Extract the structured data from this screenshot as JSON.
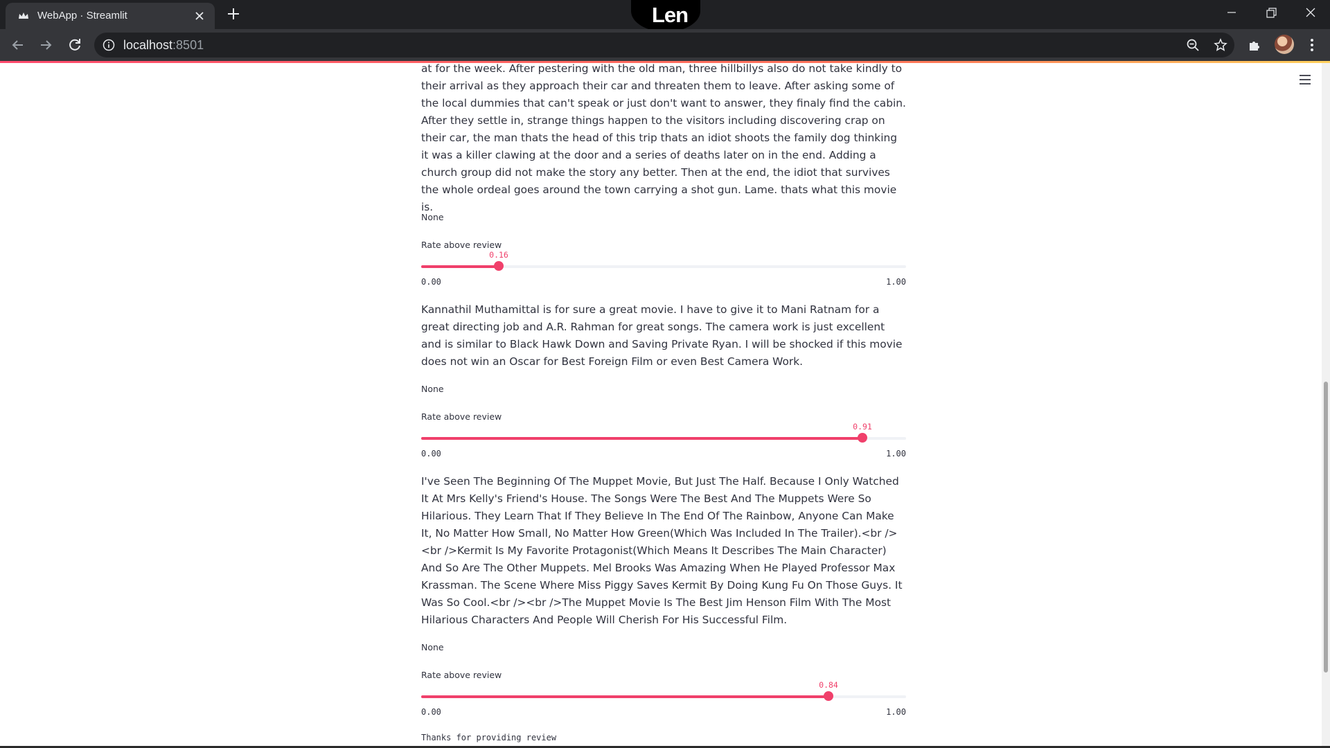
{
  "browser": {
    "tab_title": "WebApp · Streamlit",
    "overlay_text": "Len",
    "url_host": "localhost",
    "url_port": ":8501",
    "icons": {
      "favicon": "streamlit-crown-icon",
      "tab_close": "close-icon",
      "new_tab": "plus-icon",
      "minimize": "minimize-icon",
      "restore": "restore-icon",
      "close_window": "close-icon",
      "back": "arrow-left-icon",
      "forward": "arrow-right-icon",
      "reload": "reload-icon",
      "site_info": "info-icon",
      "zoom": "zoom-out-icon",
      "bookmark": "star-icon",
      "extensions": "puzzle-icon",
      "profile": "avatar",
      "menu": "kebab-menu-icon"
    }
  },
  "app": {
    "menu_icon": "hamburger-icon",
    "accent_color": "#f0406b",
    "text_color": "#31333f",
    "reviews": [
      {
        "text": "at for the week. After pestering with the old man, three hillbillys also do not take kindly to their arrival as they approach their car and threaten them to leave. After asking some of the local dummies that can't speak or just don't want to answer, they finaly find the cabin. After they settle in, strange things happen to the visitors including discovering crap on their car, the man thats the head of this trip thats an idiot shoots the family dog thinking it was a killer clawing at the door and a series of deaths later on in the end. Adding a church group did not make the story any better. Then at the end, the idiot that survives the whole ordeal goes around the town carrying a shot gun. Lame. thats what this movie is.",
        "output": "None",
        "slider_label": "Rate above review",
        "value": 0.16,
        "value_text": "0.16",
        "min_text": "0.00",
        "max_text": "1.00"
      },
      {
        "text": "Kannathil Muthamittal is for sure a great movie. I have to give it to Mani Ratnam for a great directing job and A.R. Rahman for great songs. The camera work is just excellent and is similar to Black Hawk Down and Saving Private Ryan. I will be shocked if this movie does not win an Oscar for Best Foreign Film or even Best Camera Work.",
        "output": "None",
        "slider_label": "Rate above review",
        "value": 0.91,
        "value_text": "0.91",
        "min_text": "0.00",
        "max_text": "1.00"
      },
      {
        "text": "I've Seen The Beginning Of The Muppet Movie, But Just The Half. Because I Only Watched It At Mrs Kelly's Friend's House. The Songs Were The Best And The Muppets Were So Hilarious. They Learn That If They Believe In The End Of The Rainbow, Anyone Can Make It, No Matter How Small, No Matter How Green(Which Was Included In The Trailer).<br /><br />Kermit Is My Favorite Protagonist(Which Means It Describes The Main Character) And So Are The Other Muppets. Mel Brooks Was Amazing When He Played Professor Max Krassman. The Scene Where Miss Piggy Saves Kermit By Doing Kung Fu On Those Guys. It Was So Cool.<br /><br />The Muppet Movie Is The Best Jim Henson Film With The Most Hilarious Characters And People Will Cherish For His Successful Film.",
        "output": "None",
        "slider_label": "Rate above review",
        "value": 0.84,
        "value_text": "0.84",
        "min_text": "0.00",
        "max_text": "1.00"
      }
    ],
    "thanks_text": "Thanks for providing review"
  }
}
